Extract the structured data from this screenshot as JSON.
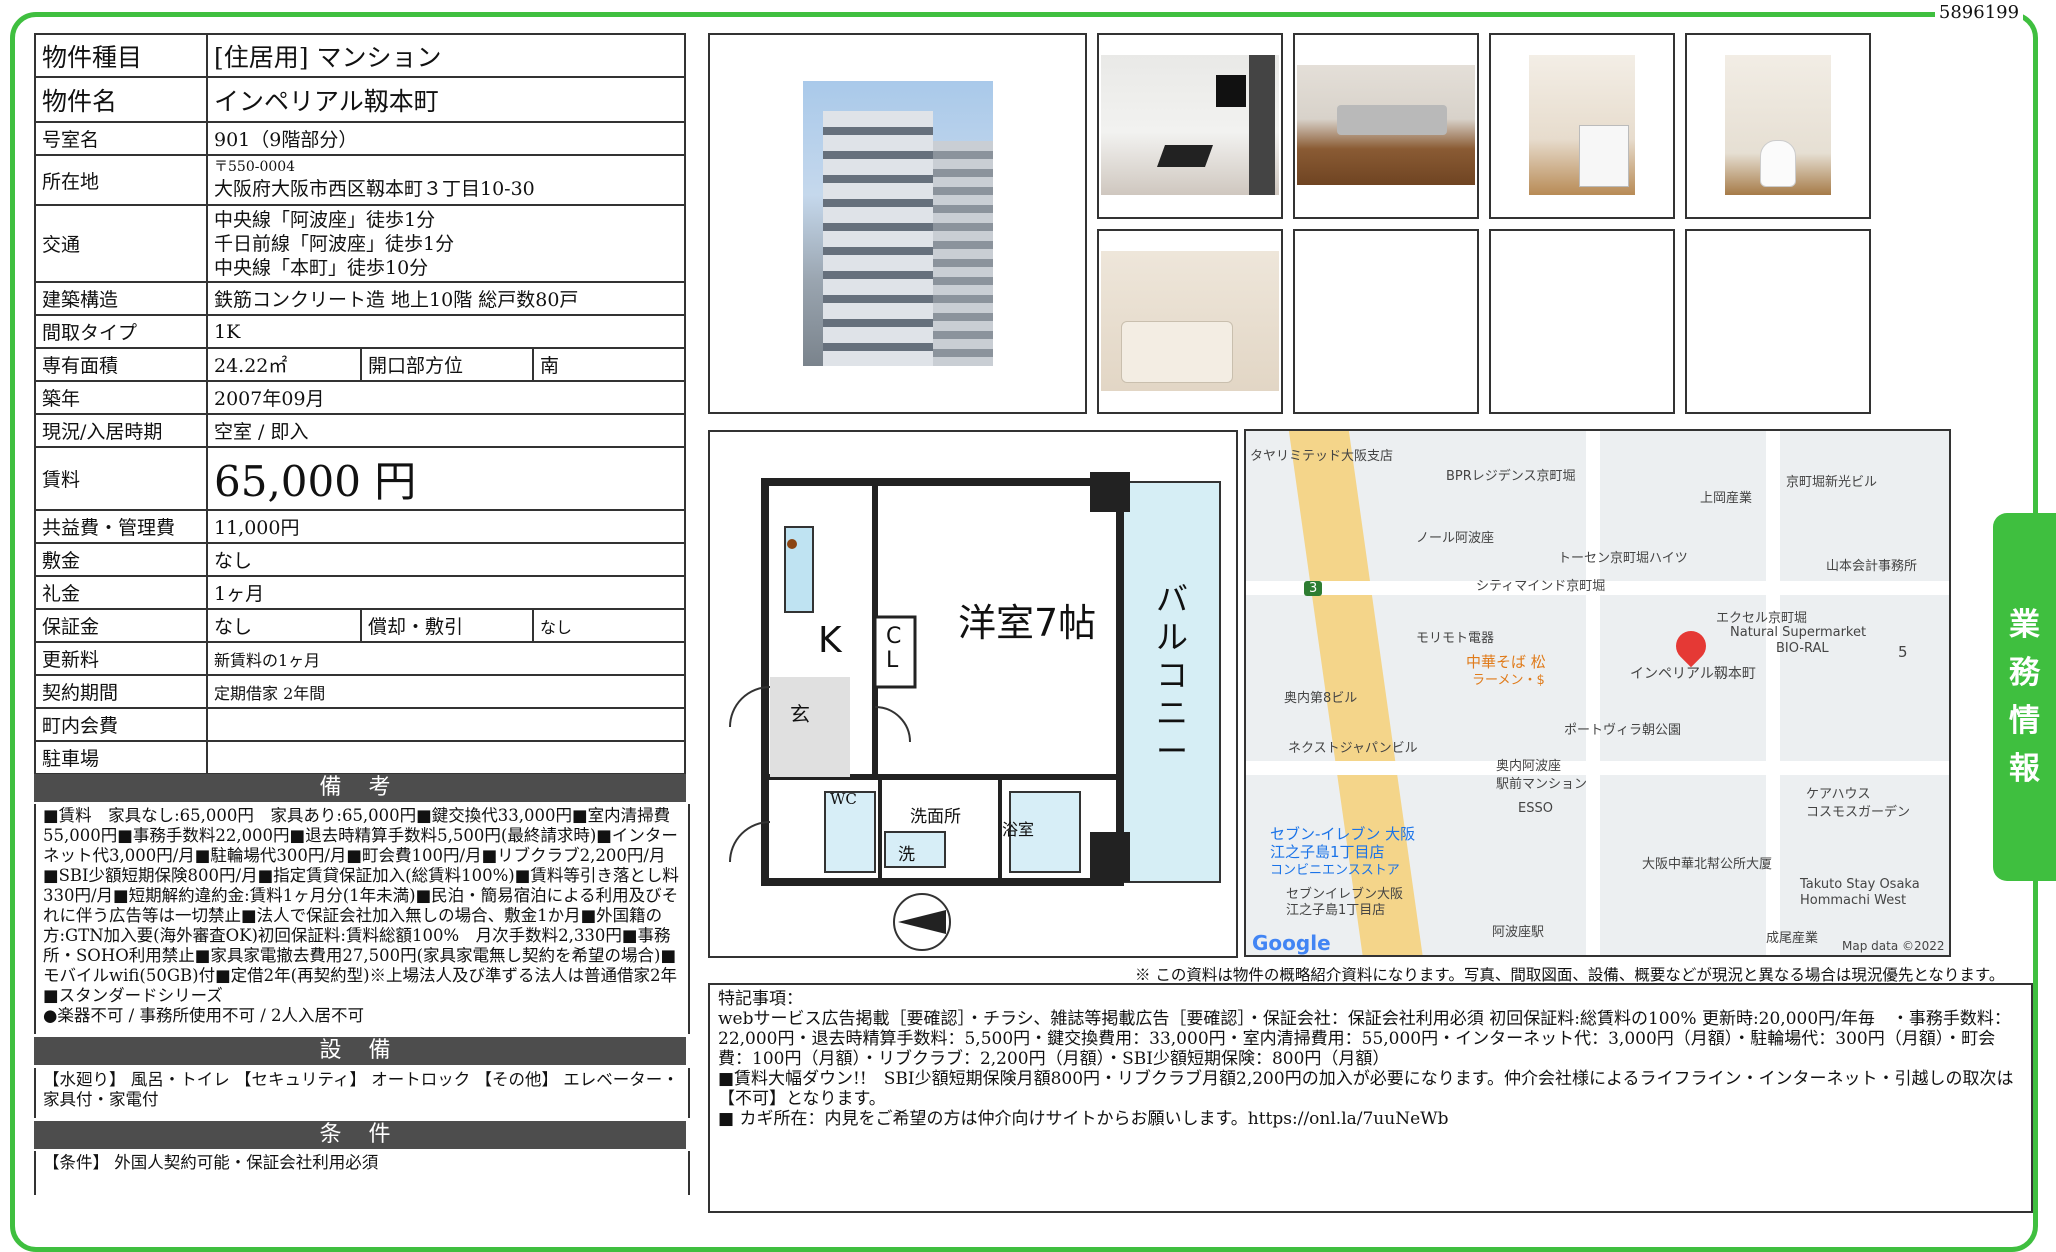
{
  "doc_id": "5896199",
  "side_tab": [
    "業",
    "務",
    "情",
    "報"
  ],
  "property": {
    "type_label": "物件種目",
    "type_value": "[住居用] マンション",
    "name_label": "物件名",
    "name_value": "インペリアル靱本町",
    "room_label": "号室名",
    "room_value": "901（9階部分）",
    "address_label": "所在地",
    "address_zip": "〒550-0004",
    "address_value": "大阪府大阪市西区靱本町３丁目10-30",
    "access_label": "交通",
    "access_lines": [
      "中央線「阿波座」徒歩1分",
      "千日前線「阿波座」徒歩1分",
      "中央線「本町」徒歩10分"
    ],
    "structure_label": "建築構造",
    "structure_value": "鉄筋コンクリート造 地上10階 総戸数80戸",
    "layout_label": "間取タイプ",
    "layout_value": "1K",
    "area_label": "専有面積",
    "area_value": "24.22㎡",
    "direction_label": "開口部方位",
    "direction_value": "南",
    "built_label": "築年",
    "built_value": "2007年09月",
    "status_label": "現況/入居時期",
    "status_value": "空室 / 即入",
    "rent_label": "賃料",
    "rent_value": "65,000 円",
    "fee_label": "共益費・管理費",
    "fee_value": "11,000円",
    "deposit_label": "敷金",
    "deposit_value": "なし",
    "key_money_label": "礼金",
    "key_money_value": "1ヶ月",
    "guarantee_label": "保証金",
    "guarantee_value": "なし",
    "amort_label": "償却・敷引",
    "amort_value": "なし",
    "renewal_label": "更新料",
    "renewal_value": "新賃料の1ヶ月",
    "contract_label": "契約期間",
    "contract_value": "定期借家 2年間",
    "community_label": "町内会費",
    "community_value": "",
    "parking_label": "駐車場",
    "parking_value": ""
  },
  "remarks": {
    "title": "備 考",
    "body": "■賃料　家具なし:65,000円　家具あり:65,000円■鍵交換代33,000円■室内清掃費55,000円■事務手数料22,000円■退去時精算手数料5,500円(最終請求時)■インターネット代3,000円/月■駐輪場代300円/月■町会費100円/月■リブクラブ2,200円/月■SBI少額短期保険800円/月■指定賃貸保証加入(総賃料100%)■賃料等引き落とし料330円/月■短期解約違約金:賃料1ヶ月分(1年未満)■民泊・簡易宿泊による利用及びそれに伴う広告等は一切禁止■法人で保証会社加入無しの場合、敷金1か月■外国籍の方:GTN加入要(海外審査OK)初回保証料:賃料総額100%　月次手数料2,330円■事務所・SOHO利用禁止■家具家電撤去費用27,500円(家具家電無し契約を希望の場合)■モバイルwifi(50GB)付■定借2年(再契約型)※上場法人及び準ずる法人は普通借家2年■スタンダードシリーズ\n●楽器不可 / 事務所使用不可 / 2人入居不可"
  },
  "equipment": {
    "title": "設 備",
    "body": "【水廻り】 風呂・トイレ 【セキュリティ】 オートロック 【その他】 エレベーター・家具付・家電付"
  },
  "conditions": {
    "title": "条 件",
    "body": "【条件】 外国人契約可能・保証会社利用必須"
  },
  "floorplan": {
    "room_label": "洋室7帖",
    "kitchen_label": "K",
    "closet_label": "C\nL",
    "entry_label": "玄",
    "balcony_label": "バルコニー",
    "wc_label": "WC",
    "washroom_label": "洗面所",
    "bath_label": "浴室",
    "washer_label": "洗"
  },
  "map": {
    "labels": [
      "タヤリミテッド大阪支店",
      "BPRレジデンス京町堀",
      "京町堀新光ビル",
      "上岡産業",
      "ノール阿波座",
      "トーセン京町堀ハイツ",
      "山本会計事務所",
      "シティマインド京町堀",
      "エクセル京町堀",
      "Natural Supermarket",
      "BIO-RAL",
      "モリモト電器",
      "中華そば 松",
      "ラーメン・$",
      "インペリアル靱本町",
      "奥内第8ビル",
      "ポートヴィラ朝公園",
      "ネクストジャパンビル",
      "奥内阿波座",
      "駅前マンション",
      "ESSO",
      "ケアハウス",
      "コスモスガーデン",
      "セブン-イレブン 大阪",
      "江之子島1丁目店",
      "コンビニエンスストア",
      "大阪中華北幇公所大厦",
      "セブンイレブン大阪",
      "江之子島1丁目店",
      "Takuto Stay Osaka",
      "Hommachi West",
      "阿波座駅",
      "成尾産業",
      "Google",
      "Map data ©2022",
      "3",
      "5"
    ]
  },
  "footnote": "※ この資料は物件の概略紹介資料になります。写真、間取図面、設備、概要などが現況と異なる場合は現況優先となります。",
  "special_notes": "特記事項：\nwebサービス広告掲載［要確認］・チラシ、雑誌等掲載広告［要確認］・保証会社：保証会社利用必須 初回保証料:総賃料の100% 更新時:20,000円/年毎　・事務手数料：22,000円・退去時精算手数料：5,500円・鍵交換費用：33,000円・室内清掃費用：55,000円・インターネット代：3,000円（月額）・駐輪場代：300円（月額）・町会費：100円（月額）・リブクラブ：2,200円（月額）・SBI少額短期保険：800円（月額）\n■賃料大幅ダウン!!　SBI少額短期保険月額800円・リブクラブ月額2,200円の加入が必要になります。仲介会社様によるライフライン・インターネット・引越しの取次は【不可】となります。\n■ カギ所在：内見をご希望の方は仲介向けサイトからお願いします。https://onl.la/7uuNeWb",
  "colors": {
    "frame": "#3fbf3f",
    "section_header": "#4d4d4d",
    "map_bg": "#eceff1"
  }
}
